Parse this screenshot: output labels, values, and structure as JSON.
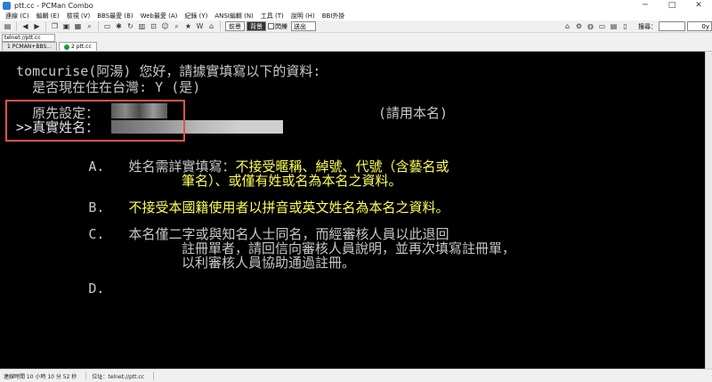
{
  "window": {
    "title": "ptt.cc - PCMan Combo",
    "minimize": "─",
    "maximize": "□",
    "close": "✕"
  },
  "menu": [
    "連線 (C)",
    "編輯 (E)",
    "檢視 (V)",
    "BBS最愛 (B)",
    "Web最愛 (A)",
    "紀錄 (Y)",
    "ANSI編輯 (N)",
    "工具 (T)",
    "說明 (H)",
    "BBI外掛"
  ],
  "toolbar": {
    "fg_label": "前景",
    "bg_label": "背景",
    "blink_label": "閃爍",
    "exit_label": "送出",
    "search_label": "搜尋：",
    "search_value": "",
    "ctrl_value": "0y"
  },
  "address": {
    "value": "telnet://ptt.cc"
  },
  "tabs": [
    {
      "label": "1 PCMAN+BBS...",
      "active": false
    },
    {
      "label": "2 ptt.cc",
      "active": true
    }
  ],
  "terminal": {
    "line1": "  tomcurise(阿湯) 您好，請據實填寫以下的資料:",
    "line2": "    是否現在住在台灣: Y (是)",
    "line3_label": "    原先設定：",
    "line3_note": "(請用本名)",
    "line4_label": "  >>真實姓名：",
    "item_a_prefix": "           A.   ",
    "item_a_white": "姓名需詳實填寫：",
    "item_a_yellow1": "不接受暱稱、綽號、代號（含藝名或",
    "item_a_yellow2": "筆名）、或僅有姓或名為本名之資料。",
    "item_b_prefix": "           B.   ",
    "item_b_yellow": "不接受本國籍使用者以拼音或英文姓名為本名之資料。",
    "item_c_prefix": "           C.   ",
    "item_c_line1": "本名僅二字或與知名人士同名，而經審核人員以此退回",
    "item_c_line2": "註冊單者，請回信向審核人員說明，並再次填寫註冊單，",
    "item_c_line3": "以利審核人員協助通過註冊。",
    "item_d_prefix": "           D."
  },
  "status": {
    "connection_time": "連線時間 10 小時 10 分 52 秒",
    "address": "位址：telnet://ptt.cc"
  },
  "colors": {
    "terminal_bg": "#000000",
    "terminal_fg": "#c8c8c8",
    "highlight_yellow": "#ffff55",
    "annotation_red": "#e0524f"
  }
}
